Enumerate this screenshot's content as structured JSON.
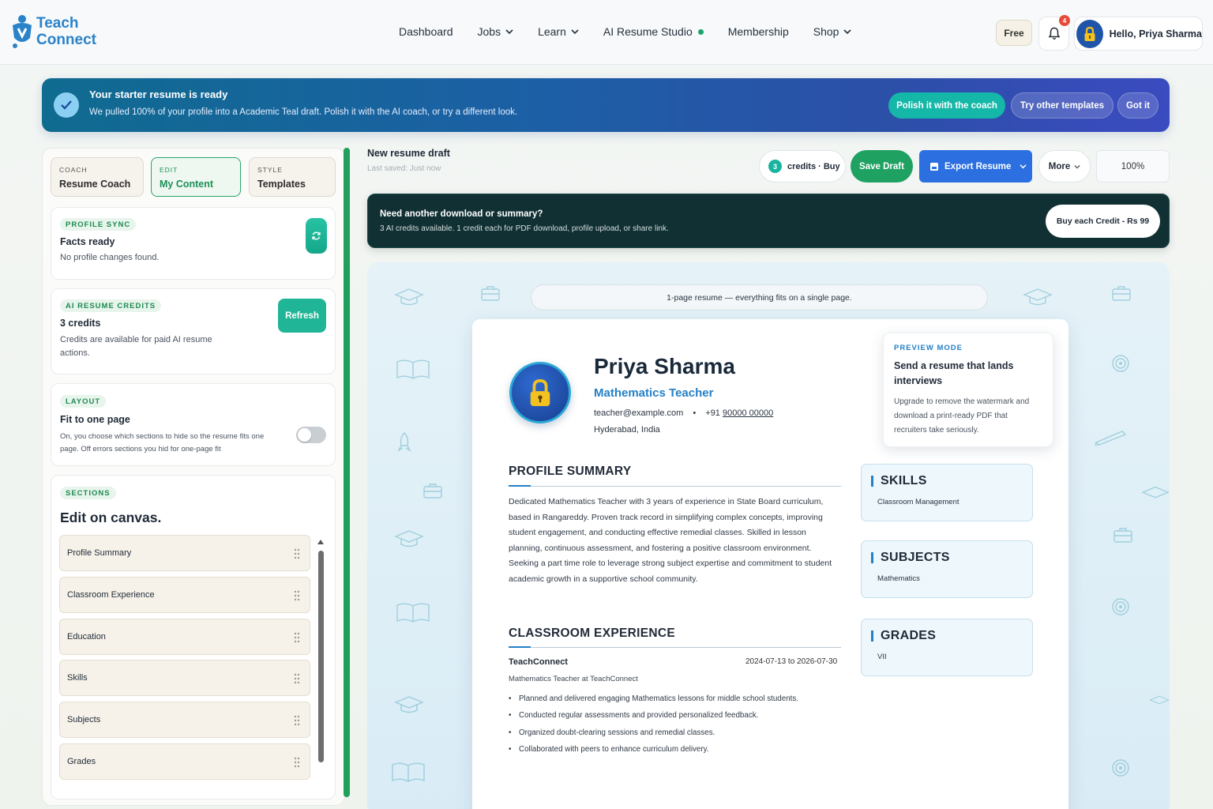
{
  "brand": {
    "line1": "Teach",
    "line2": "Connect"
  },
  "nav": [
    {
      "label": "Dashboard",
      "dropdown": false
    },
    {
      "label": "Jobs",
      "dropdown": true
    },
    {
      "label": "Learn",
      "dropdown": true
    },
    {
      "label": "AI Resume Studio",
      "dropdown": false,
      "live": true
    },
    {
      "label": "Membership",
      "dropdown": false
    },
    {
      "label": "Shop",
      "dropdown": true
    }
  ],
  "header": {
    "plan": "Free",
    "notifications": "4",
    "greeting": "Hello, Priya Sharma"
  },
  "banner": {
    "title": "Your starter resume is ready",
    "subtitle": "We pulled 100% of your profile into a Academic Teal draft. Polish it with the AI coach, or try a different look.",
    "polish_label": "Polish it with the coach",
    "templates_label": "Try other templates",
    "dismiss_label": "Got it"
  },
  "tabs": [
    {
      "kicker": "COACH",
      "label": "Resume Coach"
    },
    {
      "kicker": "EDIT",
      "label": "My Content"
    },
    {
      "kicker": "STYLE",
      "label": "Templates"
    }
  ],
  "profile_sync": {
    "chip": "PROFILE SYNC",
    "title": "Facts ready",
    "text": "No profile changes found."
  },
  "ai_credits": {
    "chip": "AI RESUME CREDITS",
    "title": "3 credits",
    "text": "Credits are available for paid AI resume actions.",
    "refresh_label": "Refresh"
  },
  "layout": {
    "chip": "LAYOUT",
    "title": "Fit to one page",
    "text": "On, you choose which sections to hide so the resume fits one page. Off errors sections you hid for one-page fit"
  },
  "sections": {
    "chip": "SECTIONS",
    "title": "Edit on canvas.",
    "items": [
      "Profile Summary",
      "Classroom Experience",
      "Education",
      "Skills",
      "Subjects",
      "Grades"
    ]
  },
  "doc": {
    "title": "New resume draft",
    "saved": "Last saved: Just now"
  },
  "toolbar": {
    "credits_count": "3",
    "credits_label": "credits · Buy",
    "save_label": "Save Draft",
    "export_label": "Export Resume",
    "more_label": "More",
    "zoom": "100%"
  },
  "credit_strip": {
    "title": "Need another download or summary?",
    "text": "3 AI credits available. 1 credit each for PDF download, profile upload, or share link.",
    "button": "Buy each Credit - Rs 99"
  },
  "canvas": {
    "notice": "1-page resume — everything fits on a single page."
  },
  "resume": {
    "name": "Priya Sharma",
    "role": "Mathematics Teacher",
    "email": "teacher@example.com",
    "phone_prefix": "+91",
    "phone": "90000 00000",
    "location": "Hyderabad, India",
    "summary_heading": "PROFILE SUMMARY",
    "summary": "Dedicated Mathematics Teacher with 3 years of experience in State Board curriculum, based in Rangareddy. Proven track record in simplifying complex concepts, improving student engagement, and conducting effective remedial classes. Skilled in lesson planning, continuous assessment, and fostering a positive classroom environment. Seeking a part time role to leverage strong subject expertise and commitment to student academic growth in a supportive school community.",
    "experience_heading": "CLASSROOM EXPERIENCE",
    "experience": {
      "org": "TeachConnect",
      "dates": "2024-07-13 to 2026-07-30",
      "role": "Mathematics Teacher at TeachConnect",
      "bullets": [
        "Planned and delivered engaging Mathematics lessons for middle school students.",
        "Conducted regular assessments and provided personalized feedback.",
        "Organized doubt-clearing sessions and remedial classes.",
        "Collaborated with peers to enhance curriculum delivery."
      ]
    },
    "side": [
      {
        "heading": "SKILLS",
        "value": "Classroom Management"
      },
      {
        "heading": "SUBJECTS",
        "value": "Mathematics"
      },
      {
        "heading": "GRADES",
        "value": "VII"
      }
    ]
  },
  "preview": {
    "kicker": "PREVIEW MODE",
    "title": "Send a resume that lands interviews",
    "text": "Upgrade to remove the watermark and download a print-ready PDF that recruiters take seriously."
  },
  "colors": {
    "accent_green": "#1fa261",
    "accent_blue": "#2480c6",
    "export_blue": "#2b6fe0",
    "teal": "#15b8a8"
  }
}
